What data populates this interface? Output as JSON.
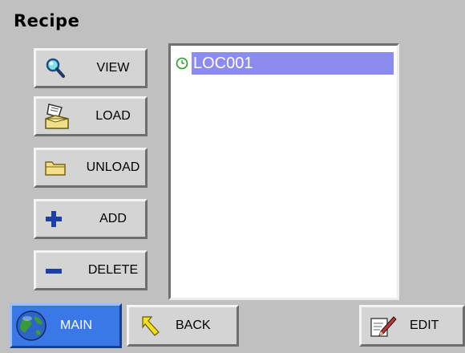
{
  "header": {
    "title": "Recipe"
  },
  "sidebar": {
    "buttons": [
      {
        "label": "VIEW",
        "icon": "magnifier-icon"
      },
      {
        "label": "LOAD",
        "icon": "load-document-icon"
      },
      {
        "label": "UNLOAD",
        "icon": "folder-icon"
      },
      {
        "label": "ADD",
        "icon": "plus-icon"
      },
      {
        "label": "DELETE",
        "icon": "minus-icon"
      }
    ]
  },
  "recipe_list": {
    "items": [
      {
        "label": "LOC001",
        "selected": true,
        "icon": "clock-icon"
      }
    ]
  },
  "footer": {
    "main_label": "MAIN",
    "back_label": "BACK",
    "edit_label": "EDIT"
  },
  "colors": {
    "background": "#c0c0c0",
    "selection": "#8c8cf0",
    "main_button": "#3a78e8"
  }
}
